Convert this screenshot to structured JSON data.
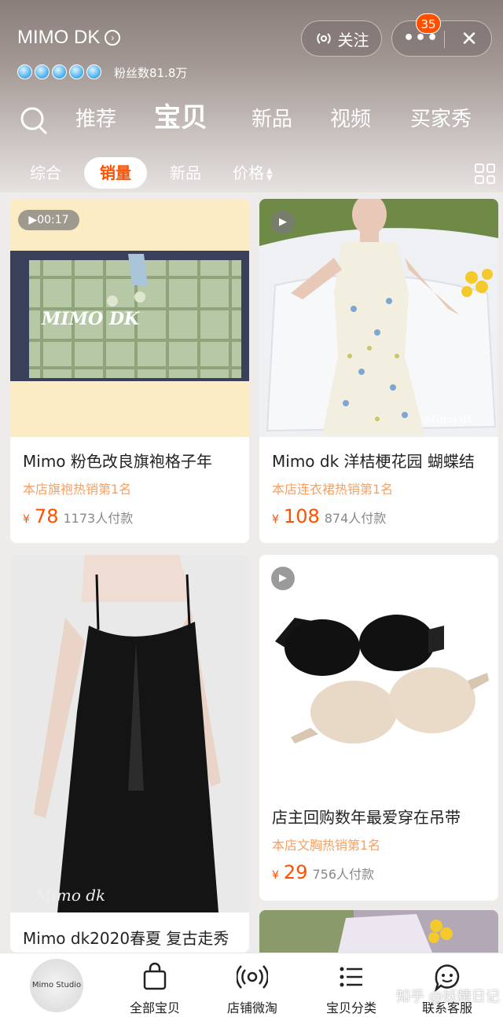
{
  "header": {
    "store_name": "MIMO DK",
    "fans_text": "粉丝数81.8万",
    "follow_label": "关注",
    "notification_count": "35",
    "accent": "#ff5000"
  },
  "nav": {
    "tabs": [
      {
        "label": "推荐"
      },
      {
        "label": "宝贝"
      },
      {
        "label": "新品"
      },
      {
        "label": "视频"
      },
      {
        "label": "买家秀"
      }
    ],
    "active_tab": "宝贝"
  },
  "sort": {
    "options": [
      {
        "label": "综合"
      },
      {
        "label": "销量"
      },
      {
        "label": "新品"
      },
      {
        "label": "价格"
      }
    ],
    "active": "销量"
  },
  "products": [
    {
      "title": "Mimo 粉色改良旗袍格子年",
      "rank": "本店旗袍热销第1名",
      "currency": "¥",
      "price": "78",
      "sold": "1173人付款",
      "video_duration": "00:17",
      "watermark": "MIMO DK"
    },
    {
      "title": "Mimo dk 洋桔梗花园 蝴蝶结",
      "rank": "本店连衣裙热销第1名",
      "currency": "¥",
      "price": "108",
      "sold": "874人付款",
      "watermark": "Mimo dk"
    },
    {
      "title": "Mimo dk2020春夏 复古走秀",
      "watermark": "Mimo dk"
    },
    {
      "title": "店主回购数年最爱穿在吊带",
      "rank": "本店文胸热销第1名",
      "currency": "¥",
      "price": "29",
      "sold": "756人付款"
    }
  ],
  "bottom_bar": {
    "logo_text": "Mimo Studio",
    "items": [
      {
        "label": "全部宝贝",
        "icon": "shopping-bag-icon"
      },
      {
        "label": "店铺微淘",
        "icon": "broadcast-icon"
      },
      {
        "label": "宝贝分类",
        "icon": "list-icon"
      },
      {
        "label": "联系客服",
        "icon": "chat-face-icon"
      }
    ]
  },
  "watermark": "知乎 @妖精日记"
}
